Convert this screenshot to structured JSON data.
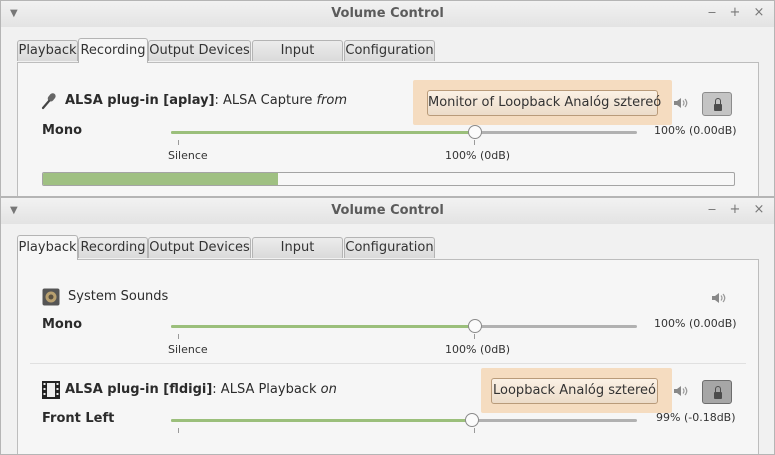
{
  "top_window": {
    "title": "Volume Control",
    "tabs": [
      "Playback",
      "Recording",
      "Output Devices",
      "Input Devices",
      "Configuration"
    ],
    "active_tab": "Recording",
    "stream": {
      "icon": "microphone-icon",
      "app_bold": "ALSA plug-in [aplay]",
      "desc": ": ALSA Capture ",
      "preposition": "from",
      "device_button": "Monitor of Loopback Analóg sztereó",
      "channel_label": "Mono",
      "volume_fraction": 1.0,
      "volume_readout": "100% (0.00dB)",
      "tick_silence": "Silence",
      "tick_full": "100% (0dB)",
      "peak_fraction": 0.34,
      "lock_icon": "lock-icon"
    }
  },
  "bottom_window": {
    "title": "Volume Control",
    "tabs": [
      "Playback",
      "Recording",
      "Output Devices",
      "Input Devices",
      "Configuration"
    ],
    "active_tab": "Playback",
    "system_sounds": {
      "icon": "system-sounds-icon",
      "label": "System Sounds",
      "channel_label": "Mono",
      "volume_fraction": 1.0,
      "volume_readout": "100% (0.00dB)",
      "tick_silence": "Silence",
      "tick_full": "100% (0dB)"
    },
    "stream": {
      "icon": "film-icon",
      "app_bold": "ALSA plug-in [fldigi]",
      "desc": ": ALSA Playback ",
      "preposition": "on",
      "device_button": "Loopback Analóg sztereó",
      "channel_label": "Front Left",
      "volume_fraction": 0.99,
      "volume_readout": "99% (-0.18dB)",
      "lock_icon": "lock-icon"
    }
  },
  "colors": {
    "device_highlight": "#f5dcc0",
    "slider_fill": "#9bbf7b",
    "peak_fill": "#9fc082"
  }
}
